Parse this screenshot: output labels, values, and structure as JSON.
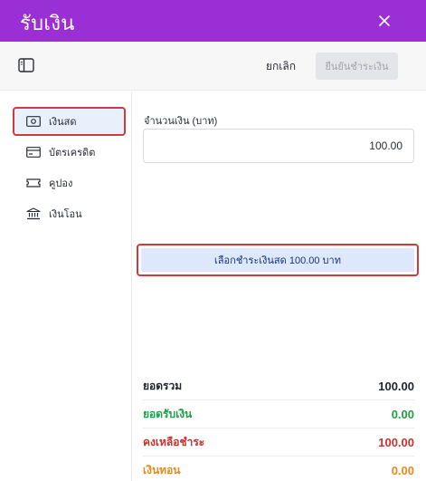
{
  "header": {
    "title": "รับเงิน",
    "close_icon": "close-icon"
  },
  "toolbar": {
    "cancel_label": "ยกเลิก",
    "confirm_label": "ยืนยันชำระเงิน",
    "sidebar_icon": "sidebar-toggle-icon"
  },
  "sidebar": {
    "items": [
      {
        "label": "เงินสด",
        "icon": "cash-icon",
        "active": true
      },
      {
        "label": "บัตรเครดิต",
        "icon": "credit-card-icon",
        "active": false
      },
      {
        "label": "คูปอง",
        "icon": "coupon-icon",
        "active": false
      },
      {
        "label": "เงินโอน",
        "icon": "bank-icon",
        "active": false
      }
    ]
  },
  "payment": {
    "amount_label": "จำนวนเงิน (บาท)",
    "amount_value": "100.00",
    "quick_select_label": "เลือกชำระเงินสด 100.00 บาท"
  },
  "summary": {
    "total_label": "ยอดรวม",
    "total_value": "100.00",
    "received_label": "ยอดรับเงิน",
    "received_value": "0.00",
    "outstanding_label": "คงเหลือชำระ",
    "outstanding_value": "100.00",
    "change_label": "เงินทอน",
    "change_value": "0.00"
  },
  "colors": {
    "header": "#9b2fd6",
    "highlight_border": "#d23a3a",
    "received": "#1e9e45",
    "outstanding": "#cf2f2f",
    "change": "#e68a1c"
  }
}
